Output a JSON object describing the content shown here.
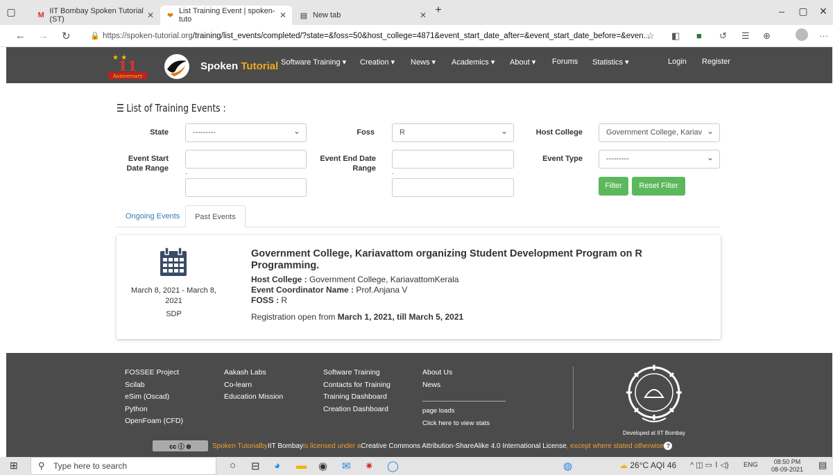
{
  "browser": {
    "tabs": [
      {
        "label": "IIT Bombay Spoken Tutorial (ST)",
        "icon": "gmail-icon"
      },
      {
        "label": "List Training Event | spoken-tuto",
        "icon": "spoken-tutorial-icon",
        "active": true
      },
      {
        "label": "New tab",
        "icon": "new-tab-icon"
      }
    ],
    "url_host": "https://spoken-tutorial.org",
    "url_path": "/training/list_events/completed/?state=&foss=50&host_college=4871&event_start_date_after=&event_start_date_before=&even..."
  },
  "site_nav": {
    "anniversary_label": "Anniversary",
    "anniversary_number": "11",
    "brand_first": "Spoken ",
    "brand_second": "Tutorial",
    "items": [
      "Software Training ▾",
      "Creation ▾",
      "News ▾",
      "Academics ▾",
      "About ▾",
      "Forums",
      "Statistics ▾",
      "Login",
      "Register"
    ]
  },
  "page": {
    "title": "List of Training Events :",
    "filters": {
      "state_label": "State",
      "state_value": "---------",
      "foss_label": "Foss",
      "foss_value": "R",
      "host_label": "Host College",
      "host_value": "Government College, Kariav",
      "start_label_1": "Event Start",
      "start_label_2": "Date Range",
      "end_label_1": "Event End Date",
      "end_label_2": "Range",
      "type_label": "Event Type",
      "type_value": "---------",
      "dash": "-",
      "filter_button": "Filter",
      "reset_button": "Reset Filter"
    },
    "tabs": [
      "Ongoing Events",
      "Past Events"
    ],
    "event": {
      "date_line_1": "March 8, 2021 - March 8,",
      "date_line_2": "2021",
      "type": "SDP",
      "title": "Government College, Kariavattom organizing Student Development Program on R Programming.",
      "host_label": "Host College :",
      "host_value": " Government College, KariavattomKerala",
      "coordinator_label": "Event Coordinator Name :",
      "coordinator_value": " Prof.Anjana V",
      "foss_label": "FOSS :",
      "foss_value": " R",
      "registration_prefix": "Registration open from ",
      "registration_dates": "March 1, 2021, till March 5, 2021"
    }
  },
  "footer": {
    "col1": [
      "FOSSEE Project",
      "Scilab",
      "eSim (Oscad)",
      "Python",
      "OpenFoam (CFD)"
    ],
    "col2": [
      "Aakash Labs",
      "Co-learn",
      "Education Mission"
    ],
    "col3": [
      "Software Training",
      "Contacts for Training",
      "Training Dashboard",
      "Creation Dashboard"
    ],
    "col4_top": [
      "About Us",
      "News"
    ],
    "page_loads": "page loads",
    "view_stats": "Click here to view stats",
    "developed_at": "Developed at IIT Bombay",
    "license_1": "Spoken Tutorial",
    "license_2": " by ",
    "license_3": "IIT Bombay",
    "license_4": " is licensed under a ",
    "license_5": "Creative Commons Attribution-ShareAlike 4.0 International License",
    "license_6": ", except where stated otherwise "
  },
  "taskbar": {
    "search_placeholder": "Type here to search",
    "weather": "26°C AQI 46",
    "lang": "ENG",
    "time": "08:50 PM",
    "date": "08-09-2021"
  },
  "colors": {
    "nav_bg": "#4b4b4b",
    "link": "#337ab7",
    "button": "#5cb85c",
    "brand_accent": "#f5a623"
  }
}
